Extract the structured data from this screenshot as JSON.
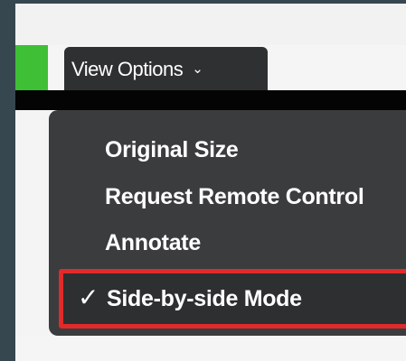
{
  "toolbar": {
    "view_options_label": "View Options",
    "view_options_icon": "chevron-down-icon",
    "accent_color": "#3fbf35"
  },
  "menu": {
    "items": [
      {
        "label": "Original Size",
        "checked": false
      },
      {
        "label": "Request Remote Control",
        "checked": false
      },
      {
        "label": "Annotate",
        "checked": false
      },
      {
        "label": "Side-by-side Mode",
        "checked": true,
        "highlighted": true
      }
    ],
    "check_glyph": "✓",
    "highlight_color": "#e12a2a"
  }
}
